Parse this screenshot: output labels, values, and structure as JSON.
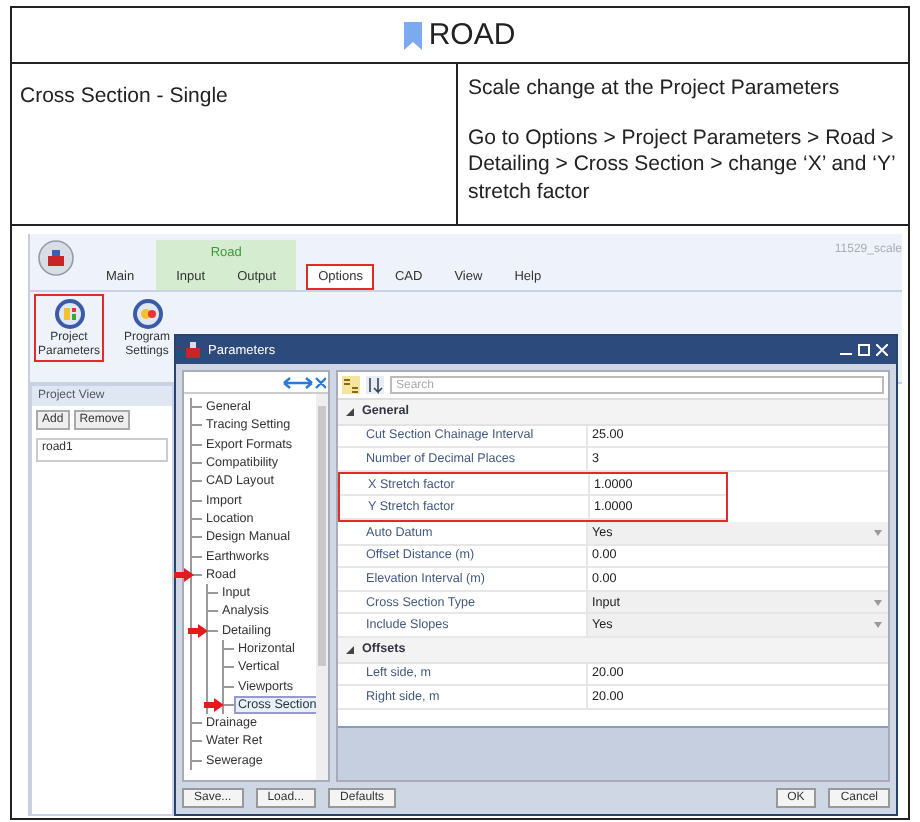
{
  "header": {
    "title": "ROAD"
  },
  "feature": "Cross Section - Single",
  "instructions": [
    "Scale change at the Project Parameters",
    "Go to Options > Project Parameters > Road > Detailing > Cross Section > change ‘X’ and ‘Y’ stretch factor"
  ],
  "app": {
    "title": "11529_scale",
    "tabs": [
      {
        "kind": "tab",
        "label": "Main",
        "selected": false,
        "highlighted": false
      },
      {
        "kind": "group",
        "label": "Road",
        "tabs": [
          {
            "kind": "tab",
            "label": "Input",
            "selected": false,
            "highlighted": false
          },
          {
            "kind": "tab",
            "label": "Output",
            "selected": false,
            "highlighted": false
          }
        ]
      },
      {
        "kind": "tab",
        "label": "Options",
        "selected": true,
        "highlighted": true
      },
      {
        "kind": "tab",
        "label": "CAD",
        "selected": false,
        "highlighted": false
      },
      {
        "kind": "tab",
        "label": "View",
        "selected": false,
        "highlighted": false
      },
      {
        "kind": "tab",
        "label": "Help",
        "selected": false,
        "highlighted": false
      }
    ],
    "ribbon_buttons": [
      {
        "label": "Project Parameters",
        "highlighted": true
      },
      {
        "label": "Program Settings",
        "highlighted": false
      }
    ],
    "project_view": {
      "title": "Project View",
      "buttons": [
        "Add",
        "Remove"
      ],
      "items": [
        "road1"
      ]
    }
  },
  "dialog": {
    "title": "Parameters",
    "search": {
      "placeholder": "Search"
    },
    "tree": [
      {
        "label": "General",
        "selected": false,
        "arrow": false
      },
      {
        "label": "Tracing Setting",
        "selected": false,
        "arrow": false
      },
      {
        "label": "Export Formats",
        "selected": false,
        "arrow": false
      },
      {
        "label": "Compatibility",
        "selected": false,
        "arrow": false
      },
      {
        "label": "CAD Layout",
        "selected": false,
        "arrow": false
      },
      {
        "label": "Import",
        "selected": false,
        "arrow": false
      },
      {
        "label": "Location",
        "selected": false,
        "arrow": false
      },
      {
        "label": "Design Manual",
        "selected": false,
        "arrow": false
      },
      {
        "label": "Earthworks",
        "selected": false,
        "arrow": false
      },
      {
        "label": "Road",
        "selected": false,
        "arrow": true,
        "children": [
          {
            "label": "Input",
            "selected": false,
            "arrow": false
          },
          {
            "label": "Analysis",
            "selected": false,
            "arrow": false
          },
          {
            "label": "Detailing",
            "selected": false,
            "arrow": true,
            "children": [
              {
                "label": "Horizontal",
                "selected": false,
                "arrow": false
              },
              {
                "label": "Vertical",
                "selected": false,
                "arrow": false
              },
              {
                "label": "Viewports",
                "selected": false,
                "arrow": false
              },
              {
                "label": "Cross Section",
                "selected": true,
                "arrow": true
              }
            ]
          }
        ]
      },
      {
        "label": "Drainage",
        "selected": false,
        "arrow": false
      },
      {
        "label": "Water Ret",
        "selected": false,
        "arrow": false
      },
      {
        "label": "Sewerage",
        "selected": false,
        "arrow": false
      }
    ],
    "grid": [
      {
        "kind": "category",
        "label": "General"
      },
      {
        "kind": "property",
        "label": "Cut Section Chainage Interval",
        "value": "25.00",
        "dropdown": false,
        "highlighted": false
      },
      {
        "kind": "property",
        "label": "Number of Decimal Places",
        "value": "3",
        "dropdown": false,
        "highlighted": false
      },
      {
        "kind": "property",
        "label": "X Stretch factor",
        "value": "1.0000",
        "dropdown": false,
        "highlighted": true
      },
      {
        "kind": "property",
        "label": "Y Stretch factor",
        "value": "1.0000",
        "dropdown": false,
        "highlighted": true
      },
      {
        "kind": "property",
        "label": "Auto Datum",
        "value": "Yes",
        "dropdown": true,
        "highlighted": false
      },
      {
        "kind": "property",
        "label": "Offset Distance (m)",
        "value": "0.00",
        "dropdown": false,
        "highlighted": false
      },
      {
        "kind": "property",
        "label": "Elevation Interval (m)",
        "value": "0.00",
        "dropdown": false,
        "highlighted": false
      },
      {
        "kind": "property",
        "label": "Cross Section Type",
        "value": "Input",
        "dropdown": true,
        "highlighted": false
      },
      {
        "kind": "property",
        "label": "Include Slopes",
        "value": "Yes",
        "dropdown": true,
        "highlighted": false
      },
      {
        "kind": "category",
        "label": "Offsets"
      },
      {
        "kind": "property",
        "label": "Left side, m",
        "value": "20.00",
        "dropdown": false,
        "highlighted": false
      },
      {
        "kind": "property",
        "label": "Right side, m",
        "value": "20.00",
        "dropdown": false,
        "highlighted": false
      }
    ],
    "buttons_left": [
      "Save...",
      "Load...",
      "Defaults"
    ],
    "buttons_right": [
      "OK",
      "Cancel"
    ]
  }
}
